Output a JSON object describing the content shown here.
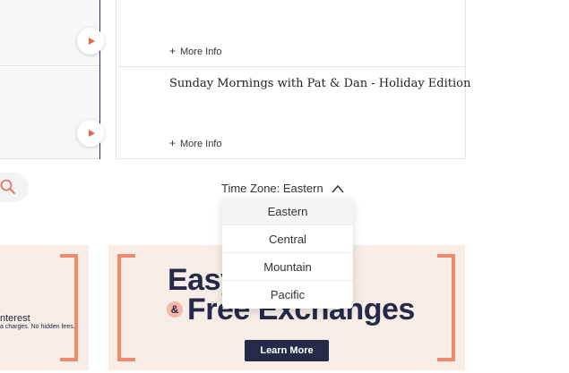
{
  "schedule": {
    "rows": [
      {
        "title": "",
        "more_info": "More Info"
      },
      {
        "title": "Sunday Mornings with Pat & Dan - Holiday Edition",
        "more_info": "More Info"
      }
    ],
    "more_info_symbol": "+"
  },
  "search": {
    "icon": "search-icon"
  },
  "timezone": {
    "label": "Time Zone: Eastern",
    "options": [
      "Eastern",
      "Central",
      "Mountain",
      "Pacific"
    ],
    "selected": "Eastern"
  },
  "banner_left": {
    "line1": "nterest",
    "line2": "a charges. No hidden fees."
  },
  "banner_right": {
    "headline_line1": "Easy",
    "amp": "&",
    "headline_line2": "Free Exchanges",
    "cta": "Learn More"
  },
  "colors": {
    "accent": "#e8664c",
    "bracket": "#f08a6c",
    "navy": "#252a48",
    "banner_bg": "#f5ede6",
    "timeline": "#2d2f6b"
  }
}
